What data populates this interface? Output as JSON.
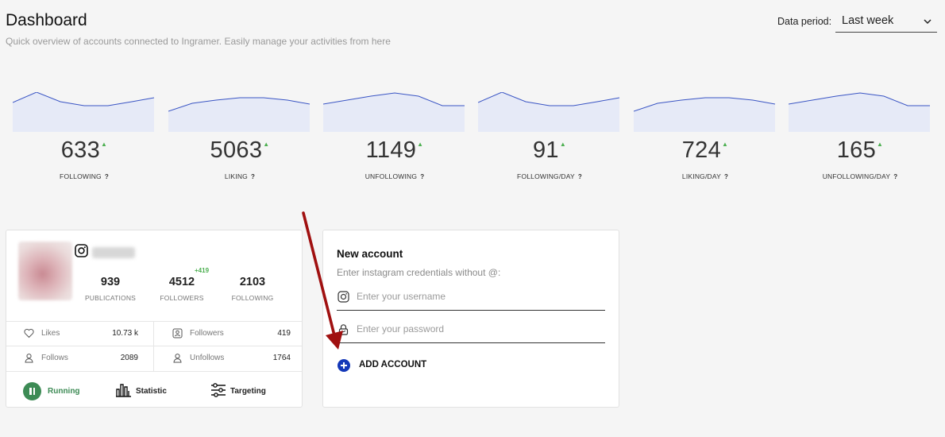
{
  "header": {
    "title": "Dashboard",
    "subtitle": "Quick overview of accounts connected to Ingramer. Easily manage your activities from here",
    "period_label": "Data period:",
    "period_value": "Last week"
  },
  "stats": [
    {
      "value": "633",
      "label": "FOLLOWING",
      "help": "?"
    },
    {
      "value": "5063",
      "label": "LIKING",
      "help": "?"
    },
    {
      "value": "1149",
      "label": "UNFOLLOWING",
      "help": "?"
    },
    {
      "value": "91",
      "label": "FOLLOWING/DAY",
      "help": "?"
    },
    {
      "value": "724",
      "label": "LIKING/DAY",
      "help": "?"
    },
    {
      "value": "165",
      "label": "UNFOLLOWING/DAY",
      "help": "?"
    }
  ],
  "colors": {
    "spark_line": "#3a55c4",
    "spark_fill": "#e6eaf7",
    "trend_up": "#4caf50",
    "running": "#3d8b55",
    "add_button": "#1438b8",
    "arrow": "#a01010"
  },
  "account": {
    "metrics": [
      {
        "value": "939",
        "label": "PUBLICATIONS"
      },
      {
        "value": "4512",
        "label": "FOLLOWERS"
      },
      {
        "value": "2103",
        "label": "FOLLOWING"
      }
    ],
    "followers_delta": "+419",
    "rows": [
      [
        {
          "icon": "heart-icon",
          "label": "Likes",
          "value": "10.73 k"
        },
        {
          "icon": "followers-icon",
          "label": "Followers",
          "value": "419"
        }
      ],
      [
        {
          "icon": "user-icon",
          "label": "Follows",
          "value": "2089"
        },
        {
          "icon": "user-icon",
          "label": "Unfollows",
          "value": "1764"
        }
      ]
    ],
    "actions": {
      "running": "Running",
      "statistic": "Statistic",
      "targeting": "Targeting"
    }
  },
  "new_account": {
    "title": "New account",
    "subtitle": "Enter instagram credentials without @:",
    "username_placeholder": "Enter your username",
    "password_placeholder": "Enter your password",
    "add_label": "ADD ACCOUNT"
  }
}
